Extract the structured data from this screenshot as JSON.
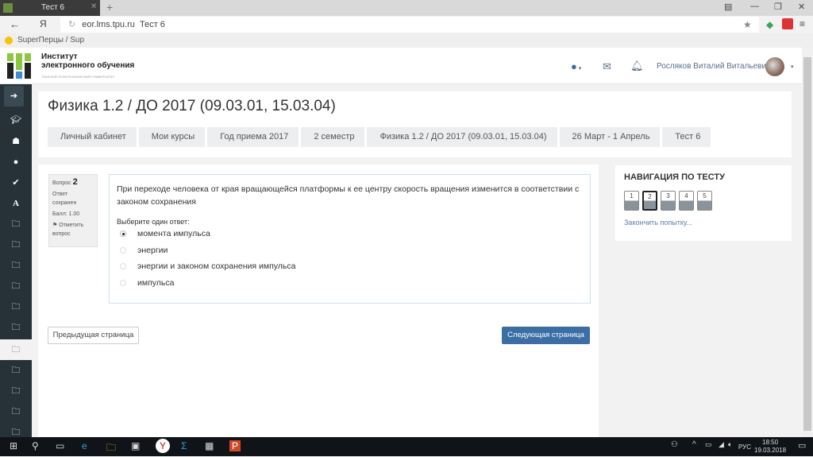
{
  "browser": {
    "tab_title": "Тест 6",
    "url_host": "eor.lms.tpu.ru",
    "url_title": "Тест 6",
    "bookmark": "SuperПерцы / Sup"
  },
  "site": {
    "brand_line1": "Институт",
    "brand_line2": "электронного обучения",
    "brand_sub": "ТОМСКИЙ ПОЛИТЕХНИЧЕСКИЙ УНИВЕРСИТЕТ",
    "user_name": "Росляков Виталий Витальевич"
  },
  "page": {
    "title": "Физика 1.2 / ДО 2017 (09.03.01, 15.03.04)",
    "breadcrumbs": [
      "Личный кабинет",
      "Мои курсы",
      "Год приема 2017",
      "2 семестр",
      "Физика 1.2 / ДО 2017 (09.03.01, 15.03.04)",
      "26 Март - 1 Апрель",
      "Тест 6"
    ]
  },
  "question": {
    "label": "Вопрос",
    "number": "2",
    "status": "Ответ сохранен",
    "score": "Балл: 1.00",
    "flag": "Отметить вопрос",
    "text": "При переходе человека от края вращающейся платформы к ее центру скорость вращения изменится в соответствии с законом сохранения",
    "prompt": "Выберите один ответ:",
    "options": [
      "момента импульса",
      "энергии",
      "энергии и законом сохранения импульса",
      "импульса"
    ],
    "selected": 0
  },
  "buttons": {
    "prev": "Предыдущая страница",
    "next": "Следующая страница"
  },
  "quiz_nav": {
    "title": "НАВИГАЦИЯ ПО ТЕСТУ",
    "pages": [
      "1",
      "2",
      "3",
      "4",
      "5"
    ],
    "current": "2",
    "finish": "Закончить попытку..."
  },
  "taskbar": {
    "lang": "РУС",
    "time": "18:50",
    "date": "19.03.2018"
  }
}
